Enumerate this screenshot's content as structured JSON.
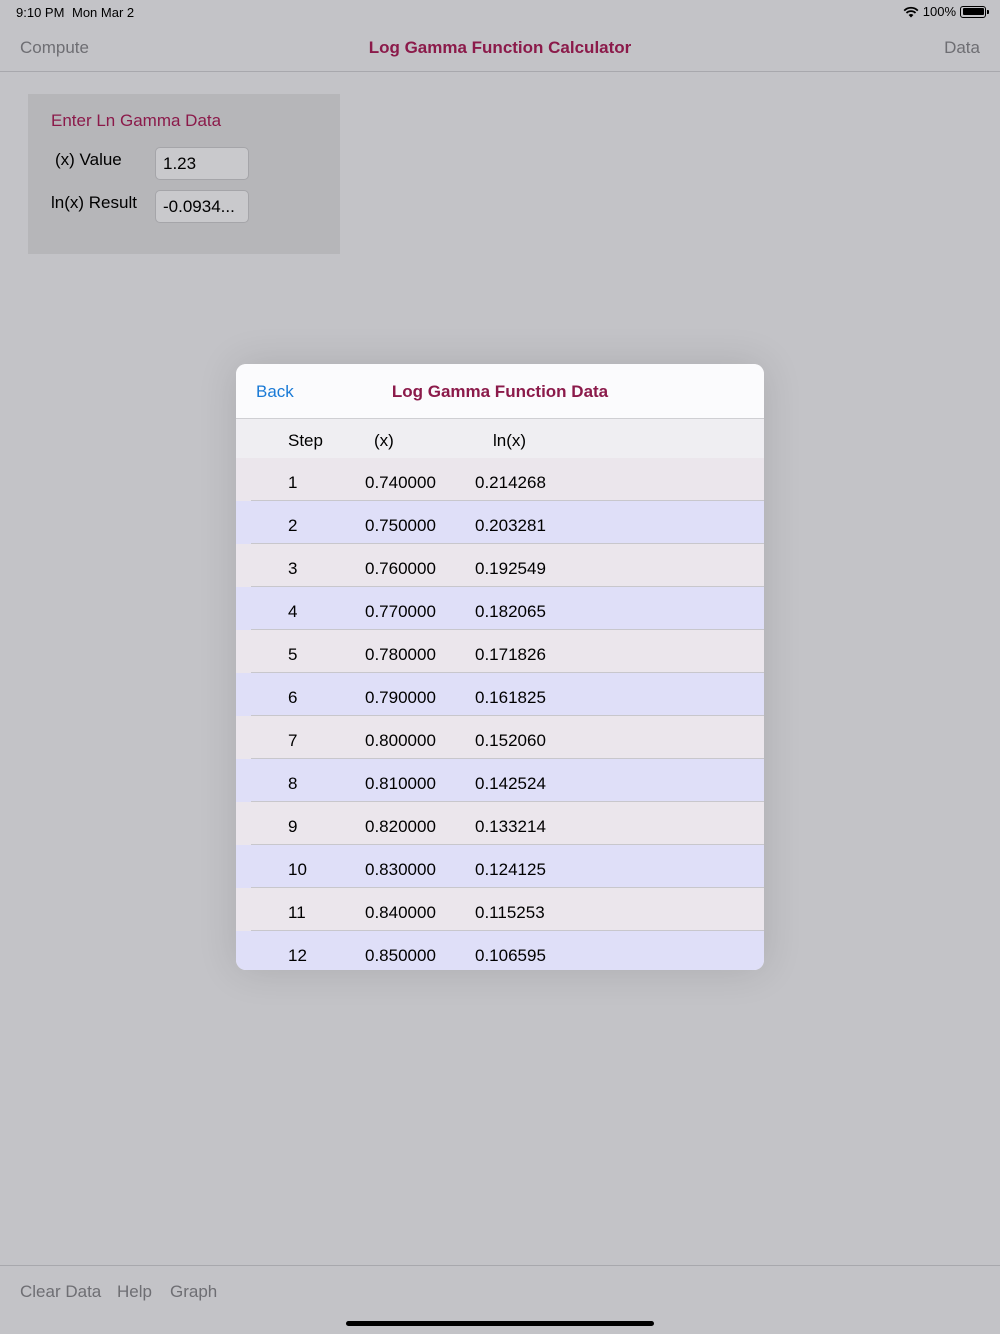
{
  "status": {
    "time": "9:10 PM",
    "date": "Mon Mar 2",
    "battery": "100%"
  },
  "nav": {
    "left_label": "Compute",
    "title": "Log Gamma Function Calculator",
    "right_label": "Data"
  },
  "input_panel": {
    "title": "Enter Ln Gamma Data",
    "x_label": "(x) Value",
    "x_value": "1.23",
    "result_label": "ln(x) Result",
    "result_value": "-0.0934..."
  },
  "modal": {
    "back_label": "Back",
    "title": "Log Gamma Function Data",
    "columns": [
      "Step",
      "(x)",
      "ln(x)"
    ],
    "rows": [
      {
        "step": "1",
        "x": "0.740000",
        "ln": "0.214268"
      },
      {
        "step": "2",
        "x": "0.750000",
        "ln": "0.203281"
      },
      {
        "step": "3",
        "x": "0.760000",
        "ln": "0.192549"
      },
      {
        "step": "4",
        "x": "0.770000",
        "ln": "0.182065"
      },
      {
        "step": "5",
        "x": "0.780000",
        "ln": "0.171826"
      },
      {
        "step": "6",
        "x": "0.790000",
        "ln": "0.161825"
      },
      {
        "step": "7",
        "x": "0.800000",
        "ln": "0.152060"
      },
      {
        "step": "8",
        "x": "0.810000",
        "ln": "0.142524"
      },
      {
        "step": "9",
        "x": "0.820000",
        "ln": "0.133214"
      },
      {
        "step": "10",
        "x": "0.830000",
        "ln": "0.124125"
      },
      {
        "step": "11",
        "x": "0.840000",
        "ln": "0.115253"
      },
      {
        "step": "12",
        "x": "0.850000",
        "ln": "0.106595"
      }
    ]
  },
  "toolbar": {
    "clear_label": "Clear Data",
    "help_label": "Help",
    "graph_label": "Graph"
  },
  "colors": {
    "title_accent": "#8b1a4a",
    "link_blue": "#1a7ad6",
    "row_odd": "#ebe6ec",
    "row_even": "#dfdff8"
  }
}
